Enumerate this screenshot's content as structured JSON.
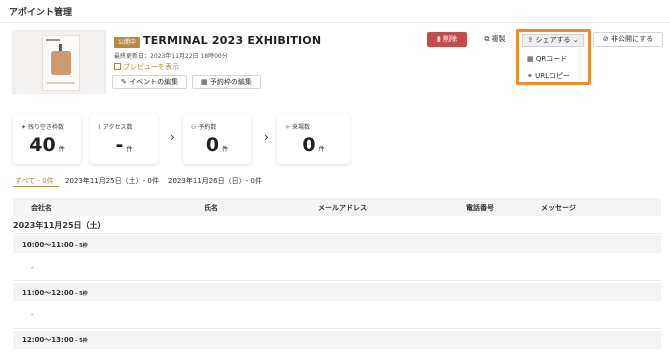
{
  "page": {
    "title": "アポイント管理"
  },
  "event": {
    "status": "公開中",
    "title": "TERMINAL 2023 EXHIBITION",
    "updated_at": "最終更新日：2023年11月22日 18時00分",
    "preview_label": "プレビューを表示",
    "edit_event_label": "イベントの編集",
    "edit_slots_label": "予約枠の編集",
    "thumbnail_icon": "event-poster-thumbnail"
  },
  "actions": {
    "delete_label": "削除",
    "copy_label": "複製",
    "share_label": "シェアする",
    "private_label": "非公開にする"
  },
  "share_menu": {
    "items": [
      {
        "label": "QRコード",
        "icon": "qr-code-icon"
      },
      {
        "label": "URLコピー",
        "icon": "link-icon"
      }
    ],
    "highlight_color": "#f08b2b"
  },
  "stats": [
    {
      "label": "残り空き枠数",
      "value": "40",
      "unit": "件",
      "icon": "pin-icon"
    },
    {
      "label": "アクセス数",
      "value": "-",
      "unit": "件",
      "icon": "chart-icon"
    },
    {
      "label": "予約数",
      "value": "0",
      "unit": "件",
      "icon": "people-icon"
    },
    {
      "label": "来場数",
      "value": "0",
      "unit": "件",
      "icon": "walk-icon"
    }
  ],
  "tabs": [
    {
      "label": "すべて - 0件",
      "active": true
    },
    {
      "label": "2023年11月25日（土）- 0件",
      "active": false
    },
    {
      "label": "2023年11月26日（日）- 0件",
      "active": false
    }
  ],
  "table": {
    "columns": [
      "会社名",
      "氏名",
      "メールアドレス",
      "電話番号",
      "メッセージ"
    ],
    "date_heading": "2023年11月25日（土）",
    "slots": [
      {
        "time": "10:00〜11:00",
        "capacity": " - 5枠",
        "value": "-"
      },
      {
        "time": "11:00〜12:00",
        "capacity": " - 5枠",
        "value": "-"
      },
      {
        "time": "12:00〜13:00",
        "capacity": " - 5枠"
      }
    ]
  },
  "colors": {
    "accent": "#b68a3c",
    "danger": "#c84a4a"
  }
}
